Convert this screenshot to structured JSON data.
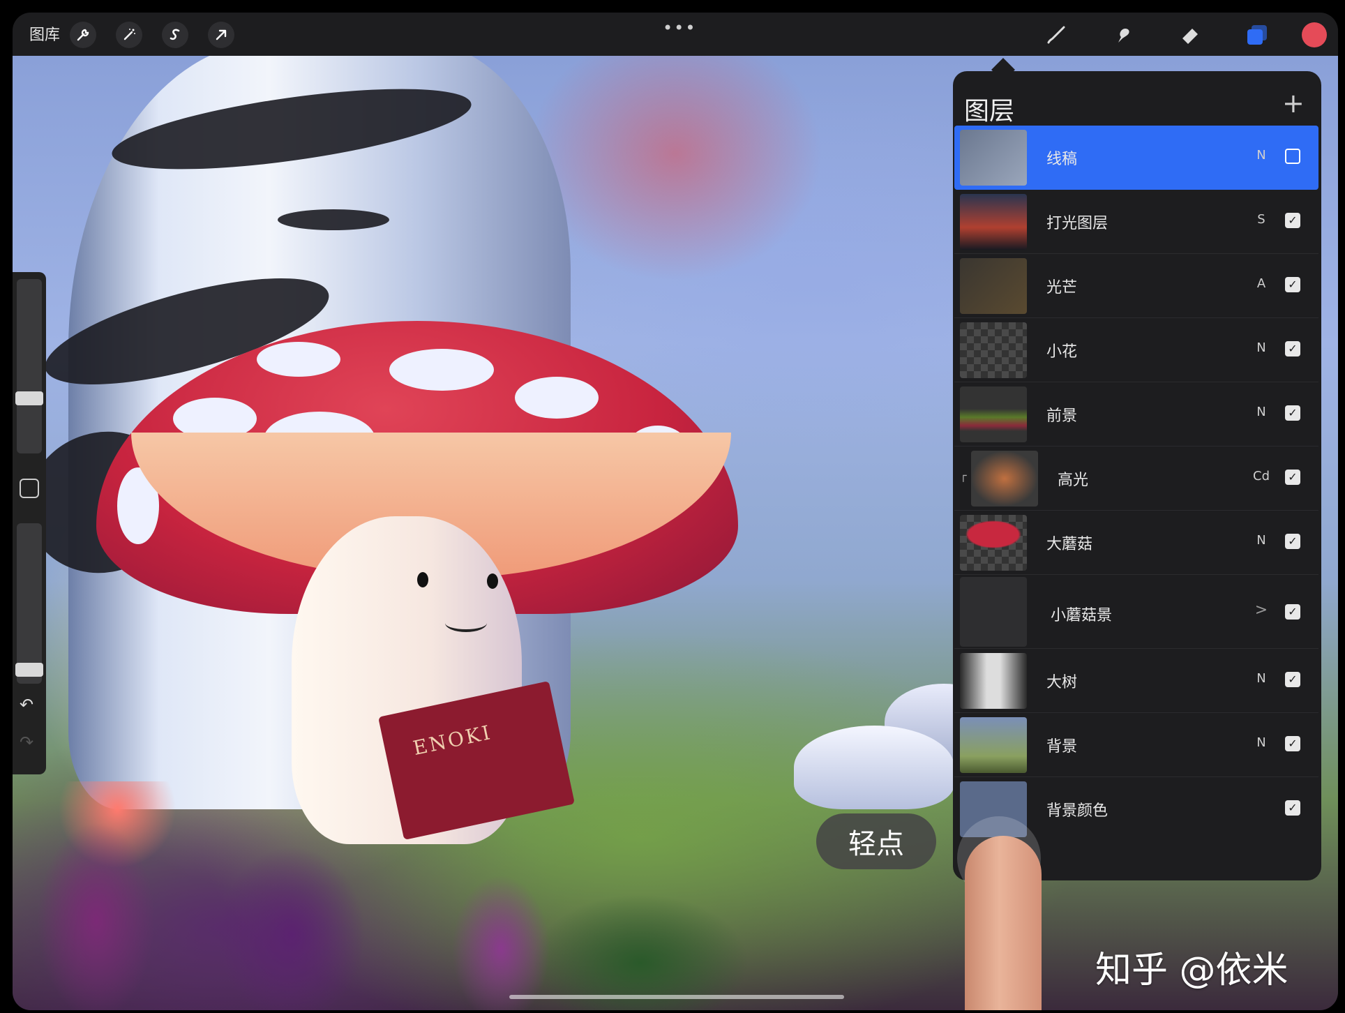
{
  "toolbar": {
    "gallery_label": "图库",
    "left_icons": [
      "wrench-icon",
      "magic-wand-icon",
      "selection-icon",
      "transform-arrow-icon"
    ],
    "more_label": "•••",
    "right_tools": [
      "brush-icon",
      "smudge-icon",
      "eraser-icon",
      "layers-icon"
    ],
    "active_tool": "layers-icon",
    "current_color": "#e54b58"
  },
  "sidebar": {
    "brush_size_level": 0.3,
    "opacity_level": 0.05,
    "undo_icon": "undo-icon",
    "redo_icon": "redo-icon"
  },
  "layers_panel": {
    "title": "图层",
    "add_label": "+",
    "layers": [
      {
        "name": "线稿",
        "blend": "N",
        "visible": false,
        "selected": true
      },
      {
        "name": "打光图层",
        "blend": "S",
        "visible": true
      },
      {
        "name": "光芒",
        "blend": "A",
        "visible": true
      },
      {
        "name": "小花",
        "blend": "N",
        "visible": true
      },
      {
        "name": "前景",
        "blend": "N",
        "visible": true
      },
      {
        "name": "高光",
        "blend": "Cd",
        "visible": true,
        "clipped": true
      },
      {
        "name": "大蘑菇",
        "blend": "N",
        "visible": true
      },
      {
        "name": "小蘑菇景",
        "blend": ">",
        "visible": true,
        "group": true
      },
      {
        "name": "大树",
        "blend": "N",
        "visible": true
      },
      {
        "name": "背景",
        "blend": "N",
        "visible": true
      },
      {
        "name": "背景颜色",
        "blend": "",
        "visible": true
      }
    ]
  },
  "artwork": {
    "book_title": "ENOKI"
  },
  "overlay": {
    "tap_label": "轻点",
    "watermark": "知乎 @依米"
  }
}
